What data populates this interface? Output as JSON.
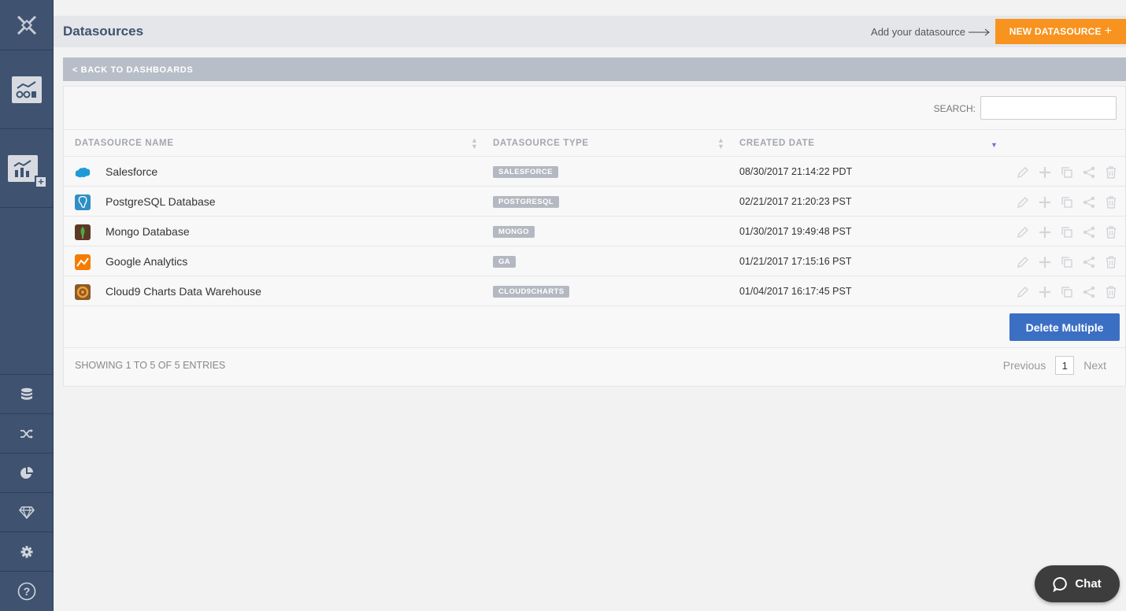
{
  "header": {
    "title": "Datasources",
    "add_hint": "Add your datasource",
    "new_button": "NEW DATASOURCE"
  },
  "back_link": "< BACK TO DASHBOARDS",
  "search": {
    "label": "SEARCH:",
    "value": "",
    "placeholder": ""
  },
  "table": {
    "columns": [
      "DATASOURCE NAME",
      "DATASOURCE TYPE",
      "CREATED DATE"
    ],
    "rows": [
      {
        "name": "Salesforce",
        "type": "SALESFORCE",
        "date": "08/30/2017 21:14:22 PDT",
        "icon": "salesforce-icon"
      },
      {
        "name": "PostgreSQL Database",
        "type": "POSTGRESQL",
        "date": "02/21/2017 21:20:23 PST",
        "icon": "postgresql-icon"
      },
      {
        "name": "Mongo Database",
        "type": "MONGO",
        "date": "01/30/2017 19:49:48 PST",
        "icon": "mongo-icon"
      },
      {
        "name": "Google Analytics",
        "type": "GA",
        "date": "01/21/2017 17:15:16 PST",
        "icon": "google-analytics-icon"
      },
      {
        "name": "Cloud9 Charts Data Warehouse",
        "type": "CLOUD9CHARTS",
        "date": "01/04/2017 16:17:45 PST",
        "icon": "cloud9charts-icon"
      }
    ]
  },
  "delete_multiple": "Delete Multiple",
  "footer": {
    "showing": "SHOWING 1 TO 5 OF 5 ENTRIES",
    "previous": "Previous",
    "page": "1",
    "next": "Next"
  },
  "chat": {
    "label": "Chat"
  },
  "colors": {
    "sidebar": "#3f5370",
    "accent_orange": "#f7931e",
    "primary_blue": "#3b6fc4",
    "badge": "#b4b9c1"
  }
}
